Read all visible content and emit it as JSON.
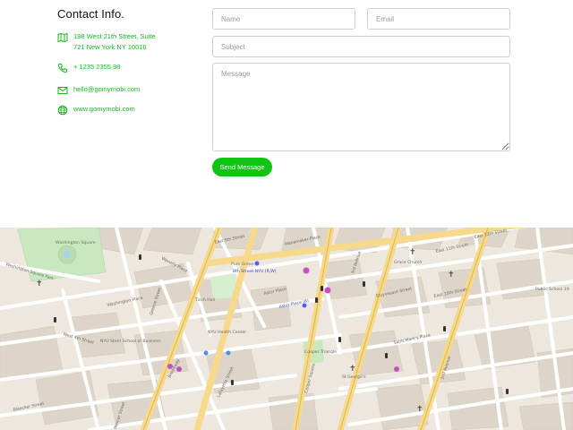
{
  "contact": {
    "title": "Contact Info.",
    "address_line1": "198 West 21th Street, Suite",
    "address_line2": "721 New York NY 10016",
    "phone": "+ 1235 2355 98",
    "email": "hello@gomymobi.com",
    "website": "www.gomymobi.com",
    "accent_color": "#1db522"
  },
  "form": {
    "name_placeholder": "Name",
    "email_placeholder": "Email",
    "subject_placeholder": "Subject",
    "message_placeholder": "Message",
    "submit_label": "Send Message",
    "button_color": "#10c414"
  },
  "map": {
    "labels": {
      "washington_square": "Washington Square",
      "washington_square_park": "Washington Square Park",
      "waverly_place": "Waverly Place",
      "washington_place": "Washington Place",
      "west_4th_street": "West 4th Street",
      "broadway": "Broadway",
      "lafayette_street": "Lafayette Street",
      "astor_place": "Astor Place",
      "astor_place_station": "Astor Place (6)",
      "eighth_street_station": "8th Street-NYU (R,W)",
      "stuyvesant_street": "Stuyvesant Street",
      "east_10th_street": "East 10th Street",
      "east_11th_street": "East 11th Street",
      "east_12th_street": "East 12th Street",
      "st_marks_place": "Saint Mark's Place",
      "third_avenue": "3rd Avenue",
      "second_avenue": "2nd Avenue",
      "cooper_square": "Cooper Square",
      "mercer_street": "Mercer Street",
      "greene_street": "Greene Street",
      "wanamaker_place": "Wanamaker Place",
      "east_9th_street": "East 9th Street",
      "bleecker_street": "Bleecker Street",
      "st_george": "St George's",
      "cooper_triangle": "Cooper Triangle",
      "nyu_health": "NYU Health Center",
      "tisch_hall": "Tisch Hall",
      "nyu_stern": "NYU Stern School of Business",
      "pure_green": "Pure Green",
      "public_school": "Public School 19",
      "grace_church": "Grace Church"
    }
  }
}
